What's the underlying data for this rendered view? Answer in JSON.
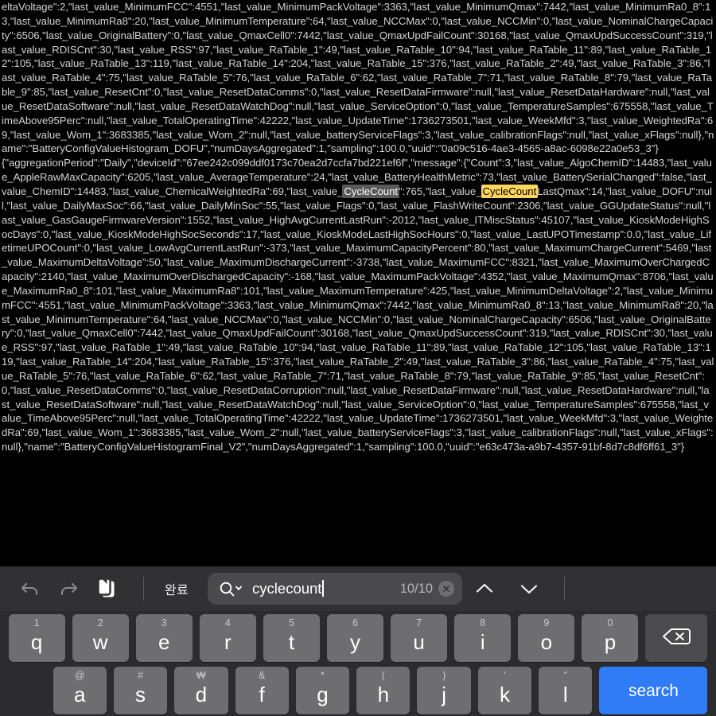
{
  "document": {
    "blocks": [
      {
        "id": "block-1-tail",
        "segments": [
          {
            "text": "eltaVoltage\":2,\"last_value_MinimumFCC\":4551,\"last_value_MinimumPackVoltage\":3363,\"last_value_MinimumQmax\":7442,\"last_value_MinimumRa0_8\":13,\"last_value_MinimumRa8\":20,\"last_value_MinimumTemperature\":64,\"last_value_NCCMax\":0,\"last_value_NCCMin\":0,\"last_value_NominalChargeCapacity\":6506,\"last_value_OriginalBattery\":0,\"last_value_QmaxCell0\":7442,\"last_value_QmaxUpdFailCount\":30168,\"last_value_QmaxUpdSuccessCount\":319,\"last_value_RDISCnt\":30,\"last_value_RSS\":97,\"last_value_RaTable_1\":49,\"last_value_RaTable_10\":94,\"last_value_RaTable_11\":89,\"last_value_RaTable_12\":105,\"last_value_RaTable_13\":119,\"last_value_RaTable_14\":204,\"last_value_RaTable_15\":376,\"last_value_RaTable_2\":49,\"last_value_RaTable_3\":86,\"last_value_RaTable_4\":75,\"last_value_RaTable_5\":76,\"last_value_RaTable_6\":62,\"last_value_RaTable_7\":71,\"last_value_RaTable_8\":79,\"last_value_RaTable_9\":85,\"last_value_ResetCnt\":0,\"last_value_ResetDataComms\":0,\"last_value_ResetDataFirmware\":null,\"last_value_ResetDataHardware\":null,\"last_value_ResetDataSoftware\":null,\"last_value_ResetDataWatchDog\":null,\"last_value_ServiceOption\":0,\"last_value_TemperatureSamples\":675558,\"last_value_TimeAbove95Perc\":null,\"last_value_TotalOperatingTime\":42222,\"last_value_UpdateTime\":1736273501,\"last_value_WeekMfd\":3,\"last_value_WeightedRa\":69,\"last_value_Wom_1\":3683385,\"last_value_Wom_2\":null,\"last_value_batteryServiceFlags\":3,\"last_value_calibrationFlags\":null,\"last_value_xFlags\":null},\"name\":\"BatteryConfigValueHistogram_DOFU\",\"numDaysAggregated\":1,\"sampling\":100.0,\"uuid\":\"0a09c516-4ae3-4565-a8ac-6098e22a0e53_3\"}",
            "style": "plain"
          }
        ]
      },
      {
        "id": "block-2",
        "segments": [
          {
            "text": "{\"aggregationPeriod\":\"Daily\",\"deviceId\":\"67ee242c099ddf0173c70ea2d7ccfa7bd221ef6f\",\"message\":{\"Count\":3,\"last_value_AlgoChemID\":14483,\"last_value_AppleRawMaxCapacity\":6205,\"last_value_AverageTemperature\":24,\"last_value_BatteryHealthMetric\":73,\"last_value_BatterySerialChanged\":false,\"last_value_ChemID\":14483,\"last_value_ChemicalWeightedRa\":69,\"last_value_",
            "style": "plain"
          },
          {
            "text": "CycleCount",
            "style": "current-match"
          },
          {
            "text": "\":765,\"last_value_",
            "style": "plain"
          },
          {
            "text": "CycleCount",
            "style": "match"
          },
          {
            "text": "LastQmax\":14,\"last_value_DOFU\":null,\"last_value_DailyMaxSoc\":66,\"last_value_DailyMinSoc\":55,\"last_value_Flags\":0,\"last_value_FlashWriteCount\":2306,\"last_value_GGUpdateStatus\":null,\"last_value_GasGaugeFirmwareVersion\":1552,\"last_value_HighAvgCurrentLastRun\":-2012,\"last_value_ITMiscStatus\":45107,\"last_value_KioskModeHighSocDays\":0,\"last_value_KioskModeHighSocSeconds\":17,\"last_value_KioskModeLastHighSocHours\":0,\"last_value_LastUPOTimestamp\":0.0,\"last_value_LifetimeUPOCount\":0,\"last_value_LowAvgCurrentLastRun\":-373,\"last_value_MaximumCapacityPercent\":80,\"last_value_MaximumChargeCurrent\":5469,\"last_value_MaximumDeltaVoltage\":50,\"last_value_MaximumDischargeCurrent\":-3738,\"last_value_MaximumFCC\":8321,\"last_value_MaximumOverChargedCapacity\":2140,\"last_value_MaximumOverDischargedCapacity\":-168,\"last_value_MaximumPackVoltage\":4352,\"last_value_MaximumQmax\":8706,\"last_value_MaximumRa0_8\":101,\"last_value_MaximumRa8\":101,\"last_value_MaximumTemperature\":425,\"last_value_MinimumDeltaVoltage\":2,\"last_value_MinimumFCC\":4551,\"last_value_MinimumPackVoltage\":3363,\"last_value_MinimumQmax\":7442,\"last_value_MinimumRa0_8\":13,\"last_value_MinimumRa8\":20,\"last_value_MinimumTemperature\":64,\"last_value_NCCMax\":0,\"last_value_NCCMin\":0,\"last_value_NominalChargeCapacity\":6506,\"last_value_OriginalBattery\":0,\"last_value_QmaxCell0\":7442,\"last_value_QmaxUpdFailCount\":30168,\"last_value_QmaxUpdSuccessCount\":319,\"last_value_RDISCnt\":30,\"last_value_RSS\":97,\"last_value_RaTable_1\":49,\"last_value_RaTable_10\":94,\"last_value_RaTable_11\":89,\"last_value_RaTable_12\":105,\"last_value_RaTable_13\":119,\"last_value_RaTable_14\":204,\"last_value_RaTable_15\":376,\"last_value_RaTable_2\":49,\"last_value_RaTable_3\":86,\"last_value_RaTable_4\":75,\"last_value_RaTable_5\":76,\"last_value_RaTable_6\":62,\"last_value_RaTable_7\":71,\"last_value_RaTable_8\":79,\"last_value_RaTable_9\":85,\"last_value_ResetCnt\":0,\"last_value_ResetDataComms\":0,\"last_value_ResetDataCorruption\":null,\"last_value_ResetDataFirmware\":null,\"last_value_ResetDataHardware\":null,\"last_value_ResetDataSoftware\":null,\"last_value_ResetDataWatchDog\":null,\"last_value_ServiceOption\":0,\"last_value_TemperatureSamples\":675558,\"last_value_TimeAbove95Perc\":null,\"last_value_TotalOperatingTime\":42222,\"last_value_UpdateTime\":1736273501,\"last_value_WeekMfd\":3,\"last_value_WeightedRa\":69,\"last_value_Wom_1\":3683385,\"last_value_Wom_2\":null,\"last_value_batteryServiceFlags\":3,\"last_value_calibrationFlags\":null,\"last_value_xFlags\":null},\"name\":\"BatteryConfigValueHistogramFinal_V2\",\"numDaysAggregated\":1,\"sampling\":100.0,\"uuid\":\"e63c473a-a9b7-4357-91bf-8d7c8df6ff61_3\"}",
            "style": "plain"
          }
        ]
      }
    ]
  },
  "toolbar": {
    "undo_label": "undo",
    "redo_label": "redo",
    "paste_label": "paste",
    "done_label": "완료",
    "search_value": "cyclecount",
    "search_placeholder": "검색",
    "match_count": "10/10",
    "clear_label": "clear",
    "prev_label": "previous match",
    "next_label": "next match"
  },
  "keyboard": {
    "row1": [
      {
        "main": "q",
        "alt": "1"
      },
      {
        "main": "w",
        "alt": "2"
      },
      {
        "main": "e",
        "alt": "3"
      },
      {
        "main": "r",
        "alt": "4"
      },
      {
        "main": "t",
        "alt": "5"
      },
      {
        "main": "y",
        "alt": "6"
      },
      {
        "main": "u",
        "alt": "7"
      },
      {
        "main": "i",
        "alt": "8"
      },
      {
        "main": "o",
        "alt": "9"
      },
      {
        "main": "p",
        "alt": "0"
      }
    ],
    "delete_label": "delete",
    "row2": [
      {
        "main": "a",
        "alt": "@"
      },
      {
        "main": "s",
        "alt": "#"
      },
      {
        "main": "d",
        "alt": "₩"
      },
      {
        "main": "f",
        "alt": "&"
      },
      {
        "main": "g",
        "alt": "*"
      },
      {
        "main": "h",
        "alt": "("
      },
      {
        "main": "j",
        "alt": ")"
      },
      {
        "main": "k",
        "alt": "'"
      },
      {
        "main": "l",
        "alt": "\""
      }
    ],
    "search_key_label": "search"
  },
  "colors": {
    "background": "#000000",
    "text": "#d4d4d4",
    "toolbar_bg": "#313133",
    "keyboard_bg": "#2c2c2e",
    "key_bg": "#6e6e70",
    "key_dark_bg": "#4b4b4d",
    "accent": "#2f7cf6",
    "highlight_current": "#5a5a5a",
    "highlight_match": "#ffd75e",
    "search_field_bg": "#4a4a4c"
  }
}
